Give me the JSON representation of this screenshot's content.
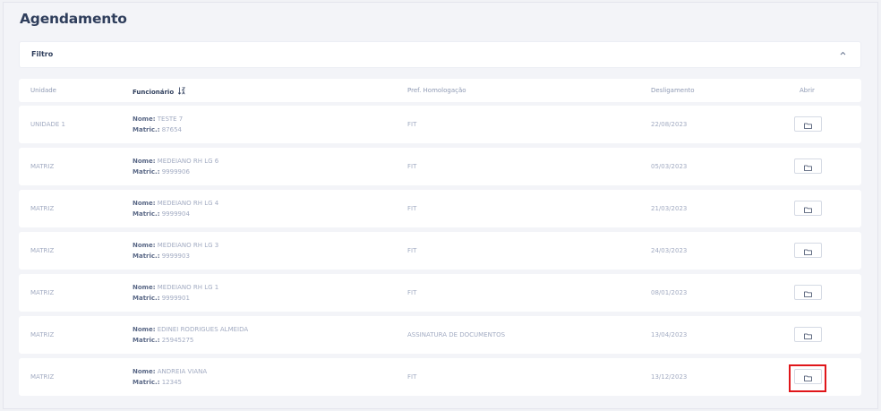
{
  "page": {
    "title": "Agendamento"
  },
  "filter": {
    "title": "Filtro",
    "toggle_icon": "chevron-up-icon"
  },
  "table": {
    "headers": {
      "unidade": "Unidade",
      "funcionario": "Funcionário",
      "pref": "Pref. Homologação",
      "desligamento": "Desligamento",
      "abrir": "Abrir"
    },
    "nome_label": "Nome:",
    "matric_label": "Matric.:",
    "rows": [
      {
        "unidade": "UNIDADE 1",
        "nome": " TESTE 7",
        "matric": " 87654",
        "pref": "FIT",
        "desligamento": "22/08/2023"
      },
      {
        "unidade": "MATRIZ",
        "nome": " MEDEIANO RH LG 6",
        "matric": " 9999906",
        "pref": "FIT",
        "desligamento": "05/03/2023"
      },
      {
        "unidade": "MATRIZ",
        "nome": " MEDEIANO RH LG 4",
        "matric": " 9999904",
        "pref": "FIT",
        "desligamento": "21/03/2023"
      },
      {
        "unidade": "MATRIZ",
        "nome": " MEDEIANO RH LG 3",
        "matric": " 9999903",
        "pref": "FIT",
        "desligamento": "24/03/2023"
      },
      {
        "unidade": "MATRIZ",
        "nome": " MEDEIANO RH LG 1",
        "matric": " 9999901",
        "pref": "FIT",
        "desligamento": "08/01/2023"
      },
      {
        "unidade": "MATRIZ",
        "nome": " EDINEI RODRIGUES ALMEIDA",
        "matric": " 25945275",
        "pref": "ASSINATURA DE DOCUMENTOS",
        "desligamento": "13/04/2023"
      },
      {
        "unidade": "MATRIZ",
        "nome": " ANDREIA VIANA",
        "matric": " 12345",
        "pref": "FIT",
        "desligamento": "13/12/2023"
      }
    ]
  },
  "colors": {
    "title": "#2f3e5c",
    "muted": "#a2abc2",
    "highlight": "#e0161a"
  }
}
